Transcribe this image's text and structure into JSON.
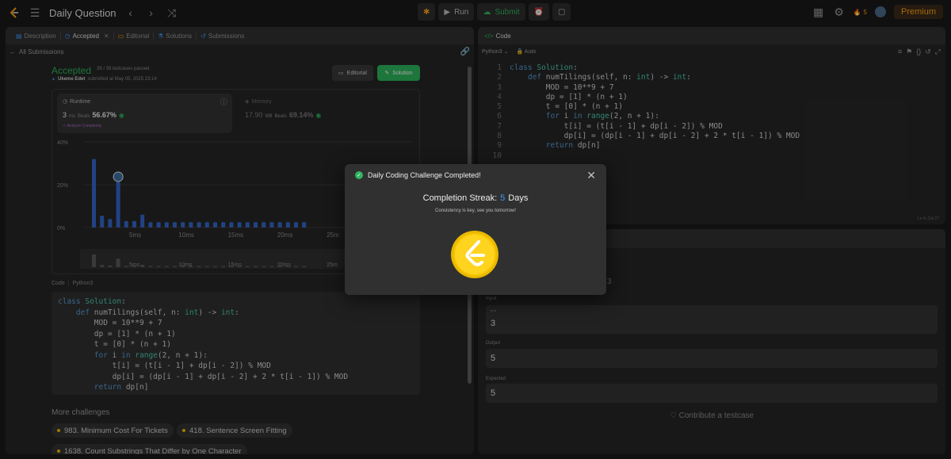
{
  "nav": {
    "title": "Daily Question",
    "run_label": "Run",
    "submit_label": "Submit",
    "streak_count": "5",
    "premium_label": "Premium"
  },
  "left_tabs": [
    {
      "label": "Description"
    },
    {
      "label": "Accepted"
    },
    {
      "label": "Editorial"
    },
    {
      "label": "Solutions"
    },
    {
      "label": "Submissions"
    }
  ],
  "submission": {
    "back_label": "All Submissions",
    "status": "Accepted",
    "testcases": "39 / 39 testcases passed",
    "user": "Ukeme Edet",
    "submitted_at": "submitted at May 05, 2025 23:14",
    "editorial_btn": "Editorial",
    "solution_btn": "Solution"
  },
  "runtime": {
    "label": "Runtime",
    "value": "3",
    "unit": "ms",
    "beats_label": "Beats",
    "beats": "56.67%",
    "analyze": "Analyze Complexity"
  },
  "memory": {
    "label": "Memory",
    "value": "17.90",
    "unit": "MB",
    "beats_label": "Beats",
    "beats": "69.14%"
  },
  "chart_data": {
    "type": "bar",
    "y_ticks": [
      "40%",
      "20%",
      "0%"
    ],
    "ylim": [
      0,
      40
    ],
    "x_ticks": [
      "5ms",
      "10ms",
      "15ms",
      "20ms",
      "25m"
    ],
    "mini_x_ticks": [
      "5ms",
      "10ms",
      "15ms",
      "20ms",
      "25m"
    ],
    "bar_color": "#3366cc",
    "values": [
      32,
      5.5,
      4,
      21.5,
      3,
      3,
      6,
      2.5,
      2.5,
      2.5,
      2.5,
      2.5,
      2.5,
      2.5,
      2.5,
      2.5,
      2.5,
      2.5,
      2.5,
      2.5,
      2.5,
      2.5,
      2.5,
      2.5,
      2.5,
      2.5,
      2.5
    ],
    "highlight_index": 3
  },
  "solution_code": {
    "lang_label": "Code",
    "lang": "Python3",
    "lines": [
      "class Solution:",
      "    def numTilings(self, n: int) -> int:",
      "        MOD = 10**9 + 7",
      "        dp = [1] * (n + 1)",
      "        t = [0] * (n + 1)",
      "        for i in range(2, n + 1):",
      "            t[i] = (t[i - 1] + dp[i - 2]) % MOD",
      "            dp[i] = (dp[i - 1] + dp[i - 2] + 2 * t[i - 1]) % MOD",
      "        return dp[n]"
    ]
  },
  "more": {
    "title": "More challenges",
    "items": [
      "983. Minimum Cost For Tickets",
      "418. Sentence Screen Fitting",
      "1638. Count Substrings That Differ by One Character"
    ]
  },
  "editor": {
    "tab_label": "Code",
    "lang": "Python3",
    "auto": "Auto",
    "line_numbers": [
      "1",
      "2",
      "3",
      "4",
      "5",
      "6",
      "7",
      "8",
      "9",
      "10"
    ],
    "status": "Ln 4, Col 27"
  },
  "testcase": {
    "input_label": "Input",
    "n_label": "n =",
    "n_value": "3",
    "stray_value": "3",
    "output_label": "Output",
    "output_value": "5",
    "expected_label": "Expected",
    "expected_value": "5",
    "contribute": "Contribute a testcase"
  },
  "modal": {
    "title": "Daily Coding Challenge Completed!",
    "streak_label": "Completion Streak:",
    "streak_value": "5",
    "streak_unit": "Days",
    "subtitle": "Consistency is key, see you tomorrow!"
  }
}
